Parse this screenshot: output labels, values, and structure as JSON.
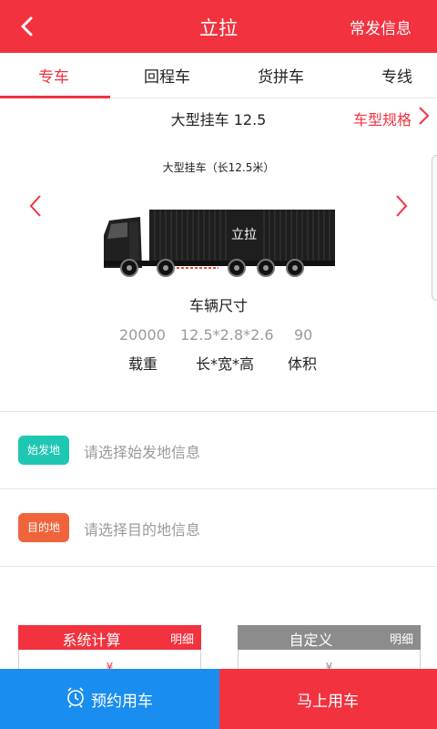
{
  "header": {
    "title": "立拉",
    "right_link": "常发信息"
  },
  "tabs": [
    {
      "label": "专车",
      "active": true
    },
    {
      "label": "回程车",
      "active": false
    },
    {
      "label": "货拼车",
      "active": false
    },
    {
      "label": "专线",
      "active": false
    }
  ],
  "model": {
    "name": "大型挂车 12.5",
    "spec_link": "车型规格"
  },
  "truck": {
    "caption": "大型挂车（长12.5米）",
    "container_logo": "立拉"
  },
  "dimensions": {
    "title": "车辆尺寸",
    "items": [
      {
        "value": "20000",
        "label": "载重"
      },
      {
        "value": "12.5*2.8*2.6",
        "label": "长*宽*高"
      },
      {
        "value": "90",
        "label": "体积"
      }
    ]
  },
  "origin": {
    "badge": "始发地",
    "placeholder": "请选择始发地信息",
    "color": "#1fc7b3"
  },
  "destination": {
    "badge": "目的地",
    "placeholder": "请选择目的地信息",
    "color": "#f0643c"
  },
  "calc": {
    "system": {
      "label": "系统计算",
      "detail": "明细",
      "mark": "¥",
      "color": "#f2323f"
    },
    "custom": {
      "label": "自定义",
      "detail": "明细",
      "mark": "¥",
      "color": "#8c8c8c"
    }
  },
  "actions": {
    "reserve": "预约用车",
    "now": "马上用车"
  },
  "colors": {
    "accent": "#f2323f",
    "reserve_blue": "#1a8ef0"
  }
}
